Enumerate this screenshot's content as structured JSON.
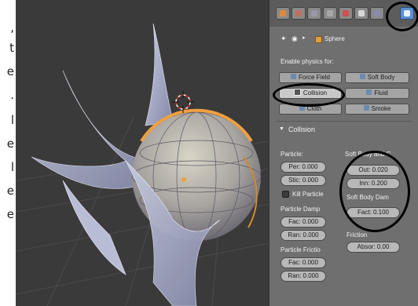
{
  "margin_text": [
    ",",
    "t",
    "e",
    ".",
    "l",
    "e",
    "l",
    "e",
    "e"
  ],
  "viewport": {
    "name": "3d-viewport"
  },
  "panel": {
    "object_name": "Sphere",
    "enable_physics_label": "Enable physics for:",
    "physics_buttons": {
      "force_field": "Force Field",
      "soft_body": "Soft Body",
      "collision": "Collision",
      "fluid": "Fluid",
      "cloth": "Cloth",
      "smoke": "Smoke"
    },
    "collision_header": "Collision",
    "particle_label": "Particle:",
    "soft_body_cloth_label": "Soft Body and C",
    "perm": "Per: 0.000",
    "stic": "Stic: 0.000",
    "kill_particles": "Kill Particle",
    "outer": "Out: 0.020",
    "inner": "Inn: 0.200",
    "soft_body_damping_label": "Soft Body Dam",
    "soft_body_factor": "Fact: 0.100",
    "particle_damping_label": "Particle Damp",
    "pd_fac": "Fac: 0.000",
    "pd_ran": "Ran: 0.000",
    "friction_label": "Friction",
    "absorb": "Absor: 0.00",
    "particle_friction_label": "Particle Frictio",
    "pf_fac": "Fac: 0.000",
    "pf_ran": "Ran: 0.000"
  },
  "colors": {
    "panel_bg": "#6f6f6f",
    "viewport_bg": "#3a3a3a",
    "active_tab": "#5b8fd0",
    "selection_orange": "#f0a040"
  }
}
